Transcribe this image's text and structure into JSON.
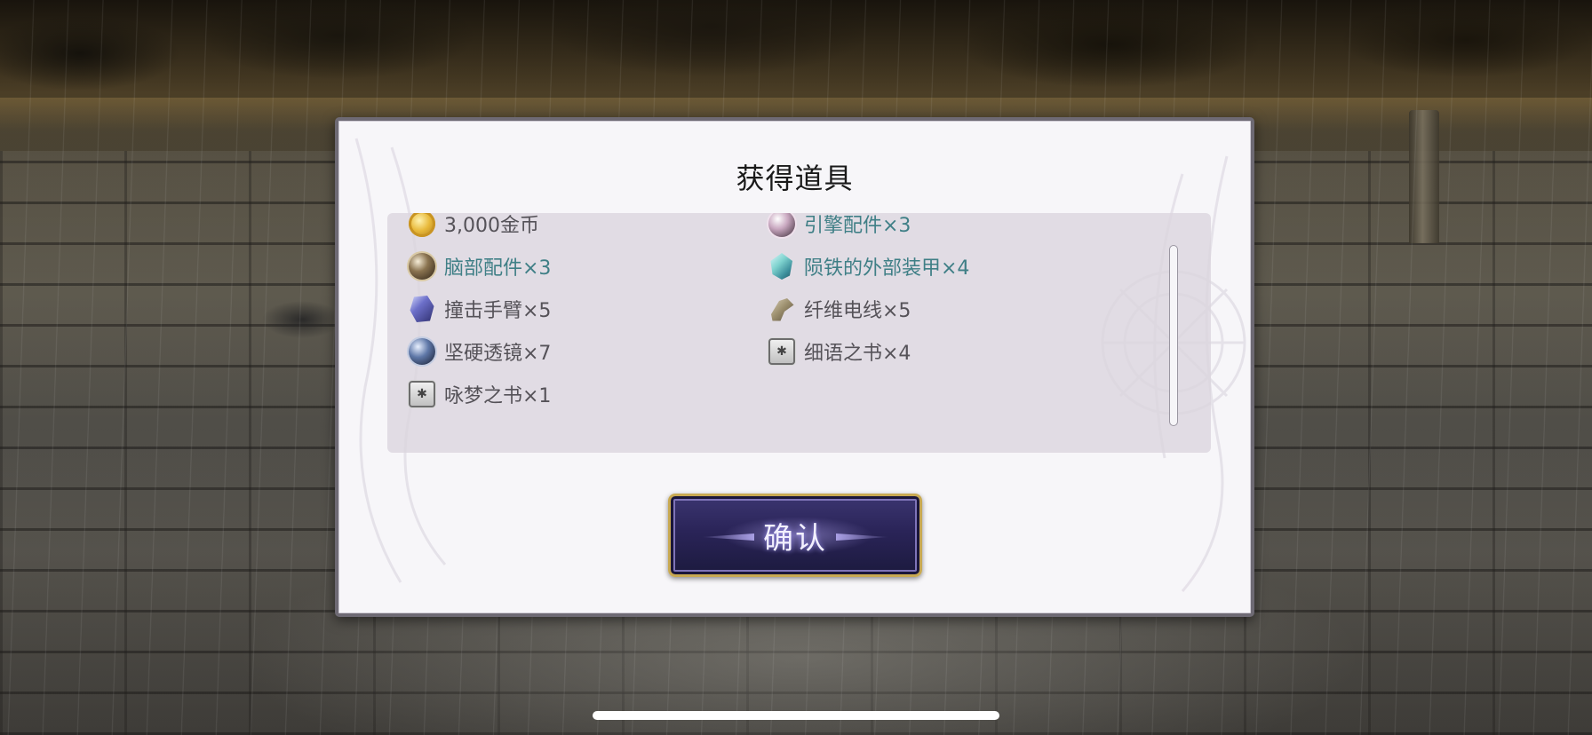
{
  "dialog": {
    "title": "获得道具",
    "confirm_label": "确认"
  },
  "items": [
    {
      "label": "3,000金币",
      "icon": "gold-coin-icon",
      "rarity": "plain"
    },
    {
      "label": "引擎配件×3",
      "icon": "engine-part-icon",
      "rarity": "rare"
    },
    {
      "label": "脑部配件×3",
      "icon": "brain-part-icon",
      "rarity": "rare"
    },
    {
      "label": "陨铁的外部装甲×4",
      "icon": "meteor-armor-icon",
      "rarity": "rare"
    },
    {
      "label": "撞击手臂×5",
      "icon": "strike-arm-icon",
      "rarity": "plain"
    },
    {
      "label": "纤维电线×5",
      "icon": "fiber-wire-icon",
      "rarity": "plain"
    },
    {
      "label": "坚硬透镜×7",
      "icon": "hard-lens-icon",
      "rarity": "plain"
    },
    {
      "label": "细语之书×4",
      "icon": "whisper-book-icon",
      "rarity": "plain"
    },
    {
      "label": "咏梦之书×1",
      "icon": "dream-book-icon",
      "rarity": "plain"
    }
  ],
  "colors": {
    "rare_text": "#3f7f86",
    "plain_text": "#555258",
    "button_frame": "#c8a952",
    "button_fill": "#2a2458"
  }
}
